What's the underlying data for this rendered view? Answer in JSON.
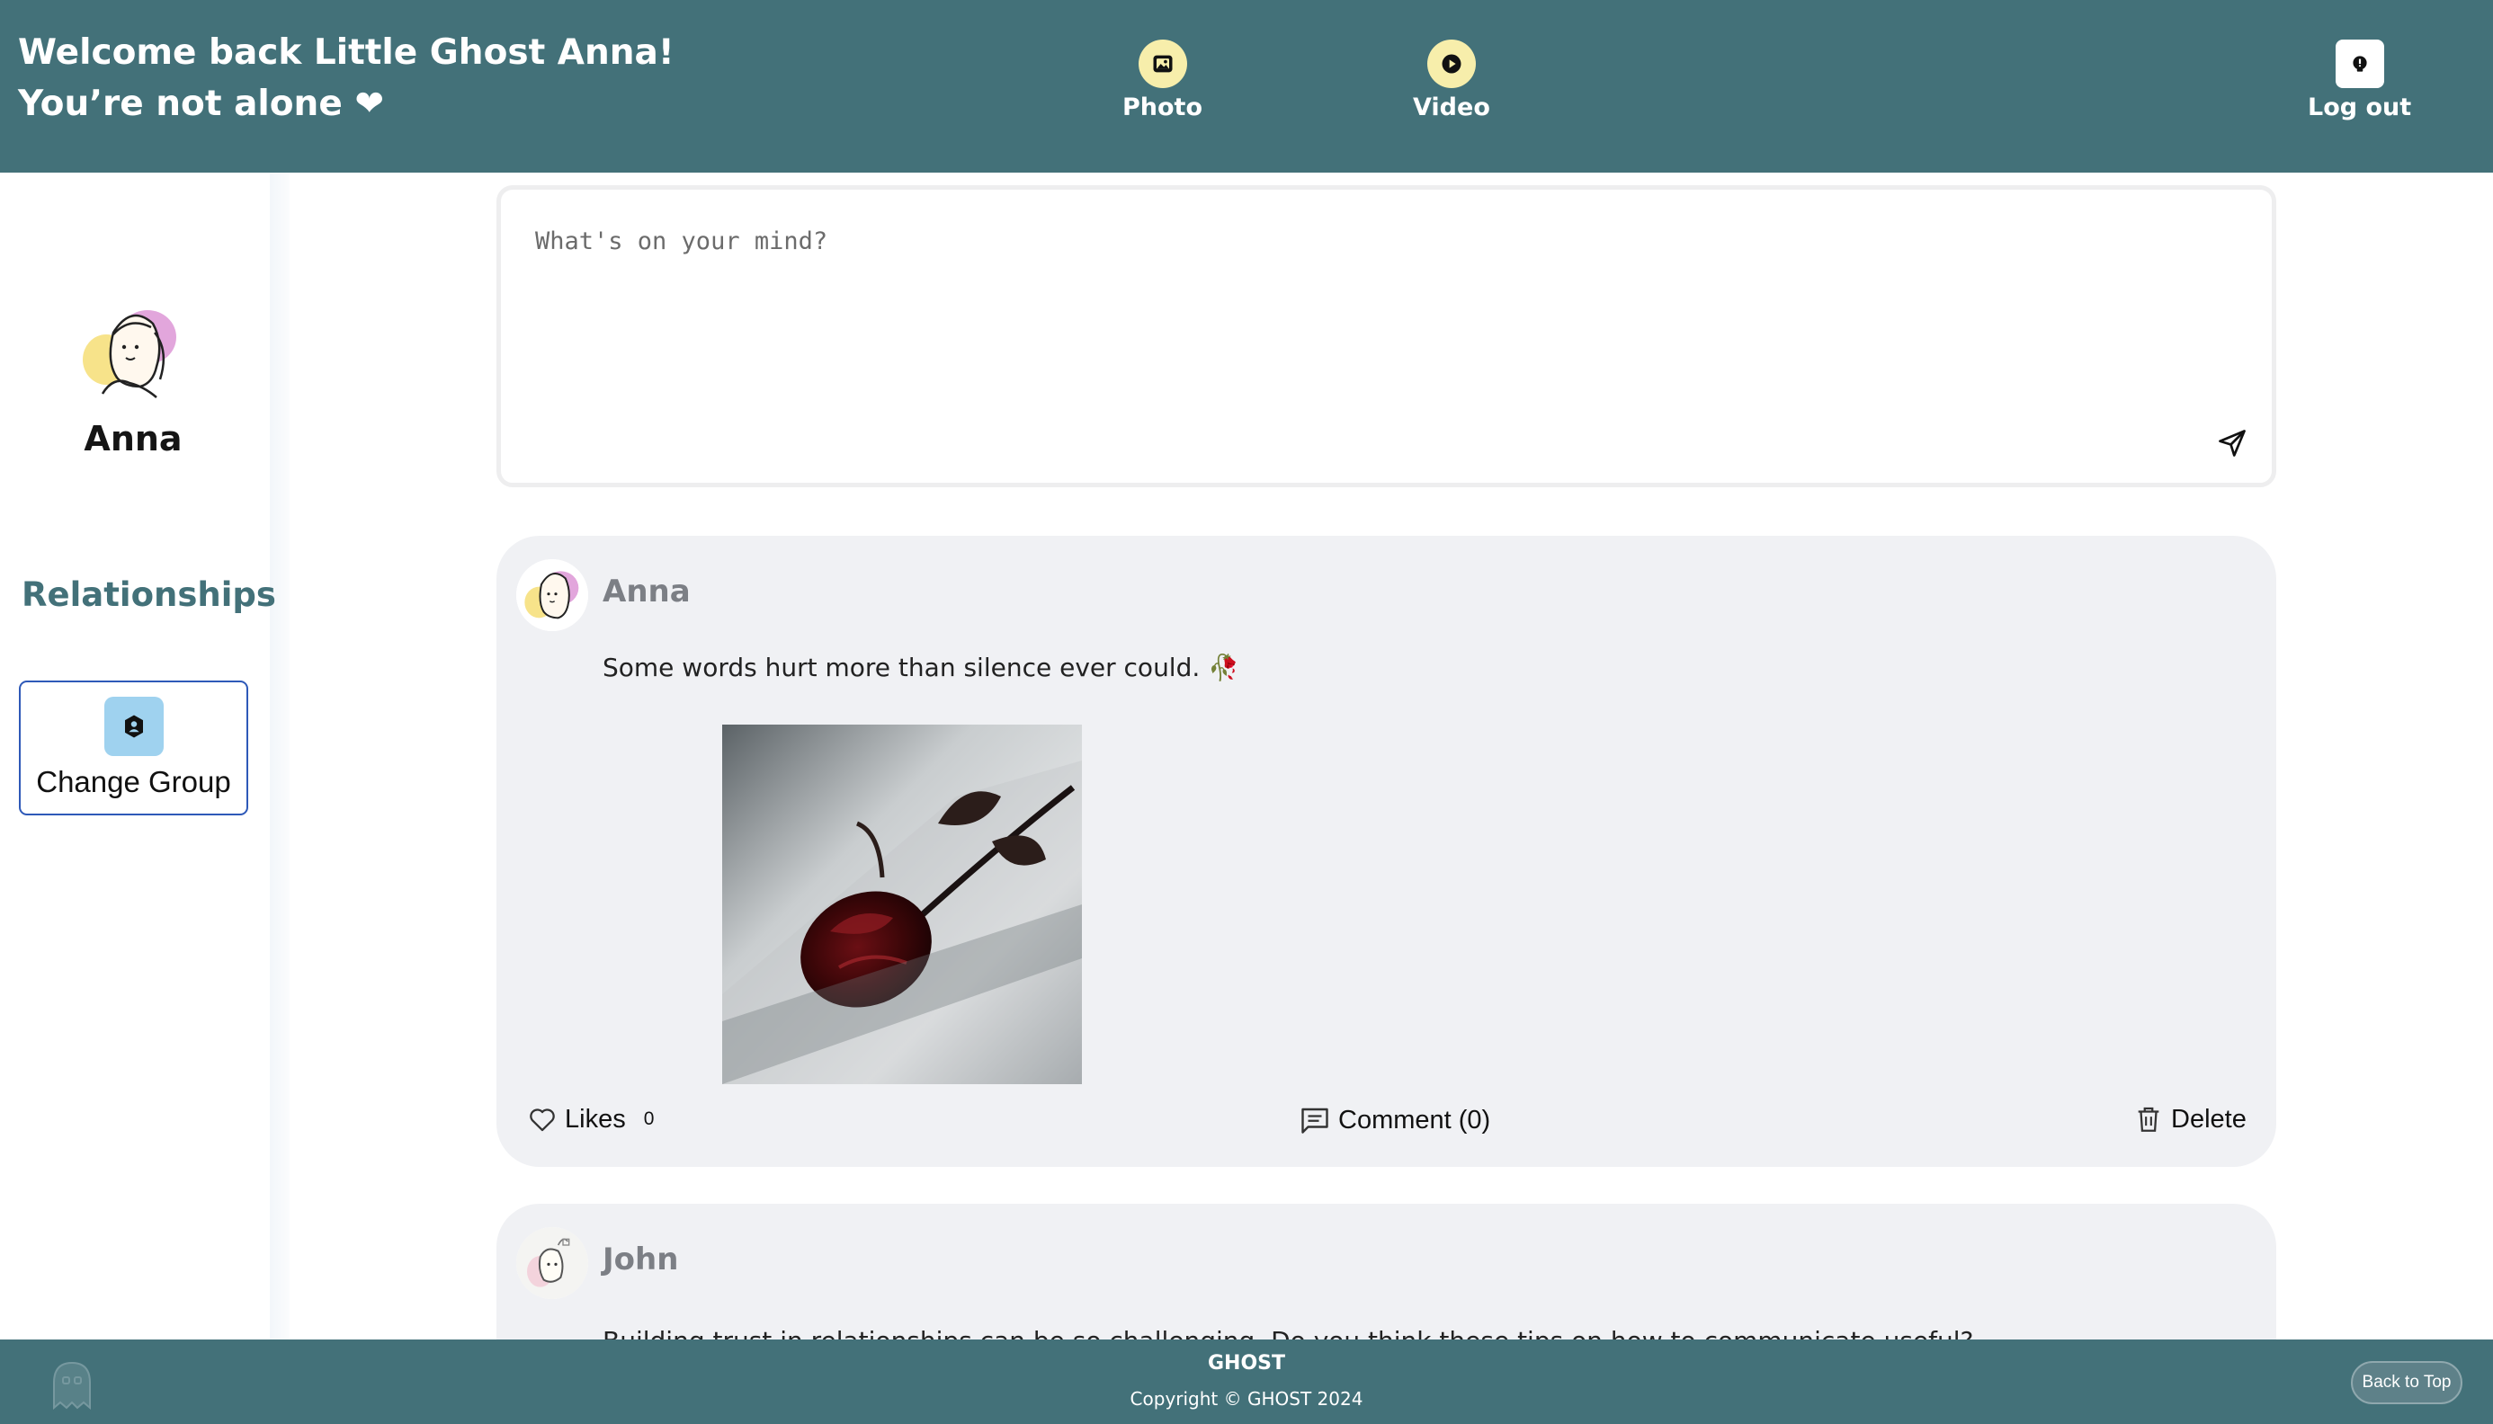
{
  "header": {
    "welcome_line1": "Welcome back Little Ghost Anna!",
    "welcome_line2": "You’re not alone ❤",
    "nav": {
      "photo_label": "Photo",
      "video_label": "Video",
      "logout_label": "Log out"
    }
  },
  "sidebar": {
    "user_name": "Anna",
    "section_title": "Relationships",
    "change_group_label": "Change Group"
  },
  "composer": {
    "placeholder": "What's on your mind?"
  },
  "posts": [
    {
      "author": "Anna",
      "text": "Some words hurt more than silence ever could. 🥀",
      "likes_label": "Likes",
      "likes_count": "0",
      "comment_label": "Comment (0)",
      "delete_label": "Delete"
    },
    {
      "author": "John",
      "text": "Building trust in relationships can be so challenging. Do you think these tips on how to communicate useful?"
    }
  ],
  "footer": {
    "brand": "GHOST",
    "copyright": "Copyright © GHOST 2024",
    "back_to_top": "Back to Top"
  },
  "colors": {
    "header_bg": "#437179",
    "accent_yellow": "#f7eeab",
    "post_bg": "#f0f1f4",
    "section_title": "#437179"
  }
}
